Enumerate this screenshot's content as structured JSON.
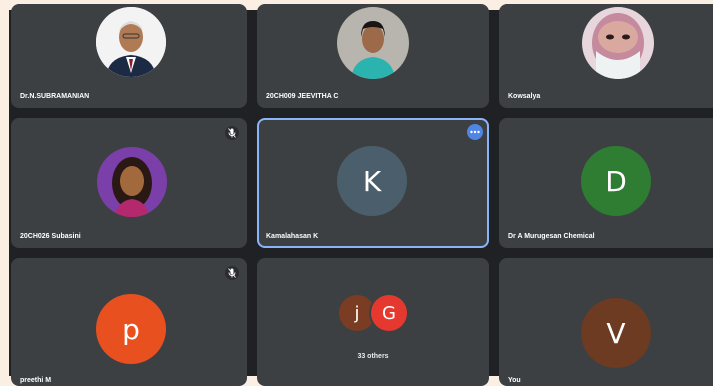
{
  "participants": [
    {
      "name": "Dr.N.SUBRAMANIAN"
    },
    {
      "name": "20CH009 JEEVITHA C"
    },
    {
      "name": "Kowsalya"
    },
    {
      "name": "20CH026 Subasini"
    },
    {
      "name": "Kamalahasan K",
      "initial": "K"
    },
    {
      "name": "Dr A Murugesan Chemical",
      "initial": "D"
    },
    {
      "name": "preethi M",
      "initial": "p"
    },
    {
      "name": "You",
      "initial": "V"
    }
  ],
  "others": {
    "label": "33 others",
    "initials": [
      "j",
      "G"
    ]
  },
  "colors": {
    "kamalahasan": "#4a5f6b",
    "murugesan": "#2e7d32",
    "preethi": "#e8511f",
    "you": "#6d3a22",
    "others_j": "#7a3d23",
    "others_g": "#e5392f",
    "active_border": "#8ab4f8"
  },
  "icons": [
    "mic-off-icon",
    "more-options-icon"
  ]
}
